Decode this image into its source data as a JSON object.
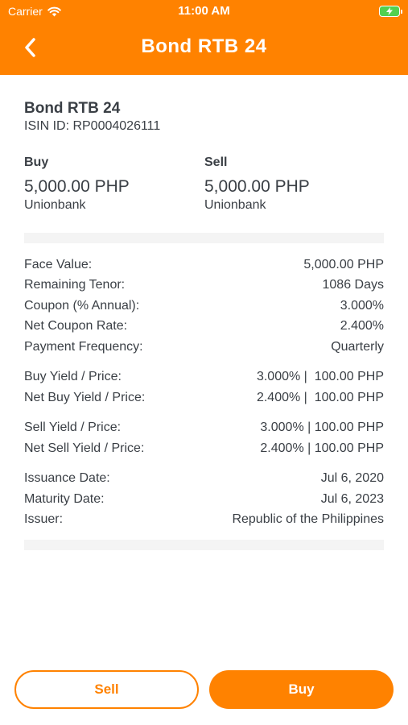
{
  "status_bar": {
    "carrier": "Carrier",
    "time": "11:00 AM"
  },
  "nav": {
    "title": "Bond RTB 24",
    "back_icon": "chevron-left-icon"
  },
  "bond": {
    "name": "Bond RTB 24",
    "isin": "ISIN ID: RP0004026111"
  },
  "buy": {
    "label": "Buy",
    "price": "5,000.00 PHP",
    "bank": "Unionbank"
  },
  "sell": {
    "label": "Sell",
    "price": "5,000.00 PHP",
    "bank": "Unionbank"
  },
  "details": [
    {
      "label": "Face Value:",
      "value": "5,000.00 PHP"
    },
    {
      "label": "Remaining Tenor:",
      "value": "1086 Days"
    },
    {
      "label": "Coupon (% Annual):",
      "value": "3.000%"
    },
    {
      "label": "Net Coupon Rate:",
      "value": "2.400%"
    },
    {
      "label": "Payment Frequency:",
      "value": "Quarterly"
    },
    {
      "label": "Buy Yield / Price:",
      "value": "3.000% |  100.00 PHP"
    },
    {
      "label": "Net Buy Yield / Price:",
      "value": "2.400% |  100.00 PHP"
    },
    {
      "label": "Sell Yield / Price:",
      "value": "3.000% | 100.00 PHP"
    },
    {
      "label": "Net Sell Yield / Price:",
      "value": "2.400% | 100.00 PHP"
    },
    {
      "label": "Issuance Date:",
      "value": "Jul 6, 2020"
    },
    {
      "label": "Maturity Date:",
      "value": "Jul 6, 2023"
    },
    {
      "label": "Issuer:",
      "value": "Republic of the Philippines"
    }
  ],
  "actions": {
    "sell_label": "Sell",
    "buy_label": "Buy"
  },
  "colors": {
    "accent": "#ff8200",
    "battery": "#52d050",
    "text": "#3a3f45"
  }
}
